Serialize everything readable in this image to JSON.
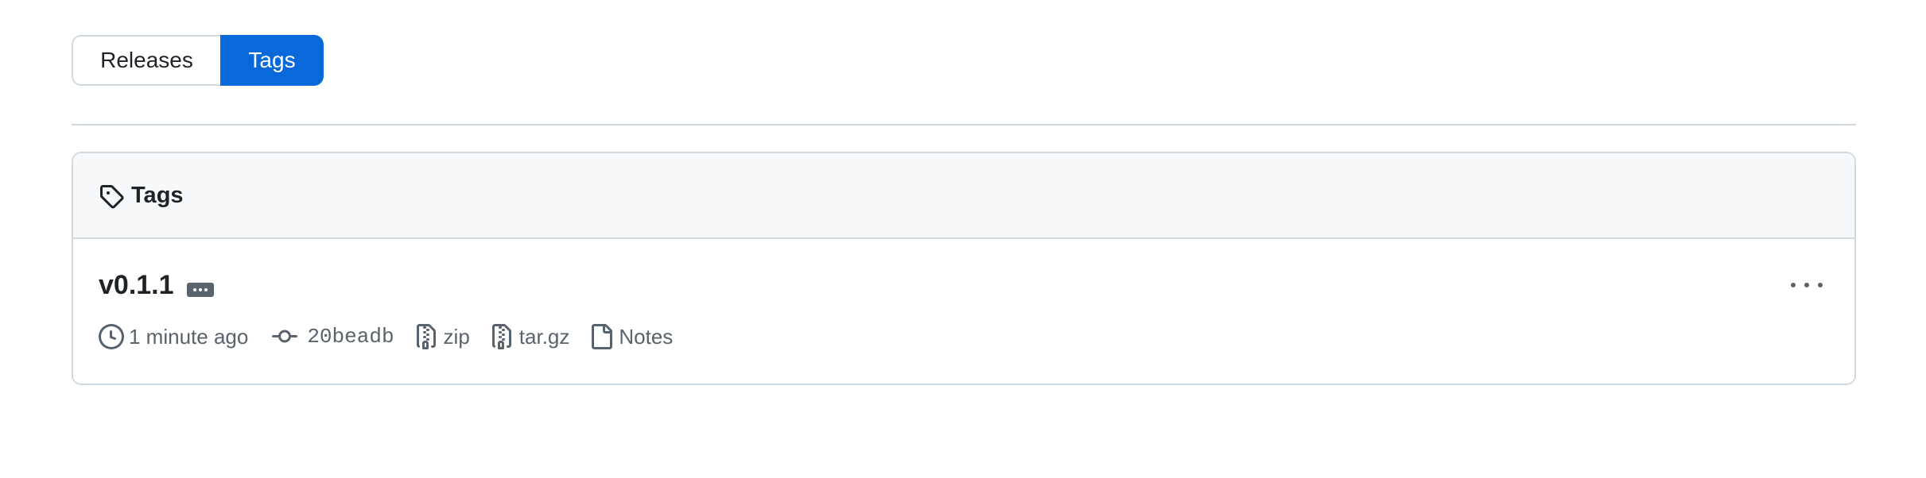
{
  "switcher": {
    "releases_label": "Releases",
    "tags_label": "Tags",
    "active": "Tags"
  },
  "tags_box": {
    "header_title": "Tags",
    "header_icon": "tag-icon"
  },
  "tag_list": [
    {
      "name": "v0.1.1",
      "time": "1 minute ago",
      "commit": "20beadb",
      "zip_label": "zip",
      "targz_label": "tar.gz",
      "notes_label": "Notes"
    }
  ],
  "colors": {
    "accent": "#0969da",
    "border": "#d1d9e0",
    "muted_text": "#59636e",
    "header_bg": "#f6f8fa",
    "text": "#1f2328"
  }
}
